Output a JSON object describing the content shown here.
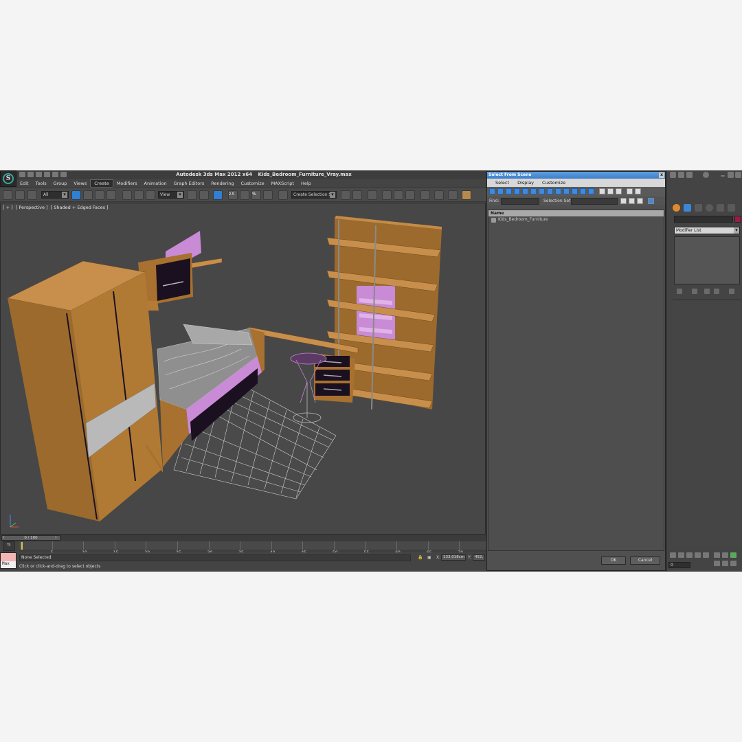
{
  "window": {
    "app_name": "Autodesk 3ds Max  2012 x64",
    "file_name": "Kids_Bedroom_Furniture_Vray.max"
  },
  "menu": [
    "Edit",
    "Tools",
    "Group",
    "Views",
    "Create",
    "Modifiers",
    "Animation",
    "Graph Editors",
    "Rendering",
    "Customize",
    "MAXScript",
    "Help"
  ],
  "toolbar": {
    "filter_select": "All",
    "ref_coord_select": "View",
    "snap_label": "2.5",
    "percent_snap_label": "%",
    "named_selection_placeholder": "Create Selection Se"
  },
  "viewport": {
    "label_bracket": "[ + ]",
    "label_view": "[ Perspective ]",
    "label_shading": "[ Shaded + Edged Faces ]"
  },
  "timeline": {
    "frame_readout": "0 / 100",
    "ticks": [
      "0",
      "5",
      "10",
      "15",
      "20",
      "25",
      "30",
      "35",
      "40",
      "45",
      "50",
      "55",
      "60",
      "65",
      "70"
    ]
  },
  "status": {
    "selection": "None Selected",
    "prompt": "Click or click-and-drag to select objects",
    "x_label": "X:",
    "x_value": "133,018cm",
    "y_label": "Y:",
    "y_value": "452,",
    "maxscript_label": "Max"
  },
  "dialog": {
    "title": "Select From Scene",
    "close": "x",
    "menu": [
      "Select",
      "Display",
      "Customize"
    ],
    "find_label": "Find:",
    "selection_set_label": "Selection Set:",
    "column_name": "Name",
    "items": [
      "Kids_Bedroom_Furniture"
    ],
    "ok": "OK",
    "cancel": "Cancel"
  },
  "command_panel": {
    "modifier_list": "Modifier List",
    "frame_value": "0",
    "object_color": "#9a1c45"
  },
  "colors": {
    "accent_blue": "#2f7fd4",
    "dialog_title": "#3f7fc8",
    "wood": "#b07a34",
    "lilac": "#c98ad6"
  }
}
